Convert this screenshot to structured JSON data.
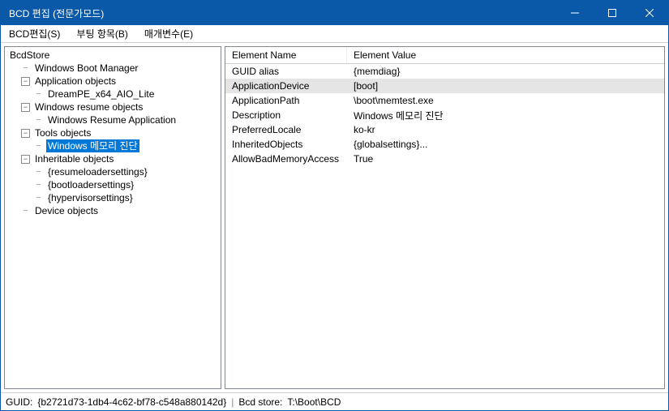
{
  "window": {
    "title": "BCD 편집 (전문가모드)"
  },
  "menu": {
    "bcd_edit": "BCD편집(S)",
    "boot_items": "부팅 항목(B)",
    "params": "매개변수(E)"
  },
  "tree": {
    "root": "BcdStore",
    "wbm": "Windows Boot Manager",
    "appobjs": "Application objects",
    "dreampe": "DreamPE_x64_AIO_Lite",
    "wro": "Windows resume objects",
    "wra": "Windows Resume Application",
    "toolsobj": "Tools objects",
    "memdiag": "Windows 메모리 진단",
    "inhobj": "Inheritable objects",
    "resumelo": "{resumeloadersettings}",
    "bootlo": "{bootloadersettings}",
    "hypset": "{hypervisorsettings}",
    "devobj": "Device objects"
  },
  "grid": {
    "hdr_name": "Element Name",
    "hdr_value": "Element Value",
    "rows": [
      {
        "n": "GUID alias",
        "v": "{memdiag}"
      },
      {
        "n": "ApplicationDevice",
        "v": "[boot]"
      },
      {
        "n": "ApplicationPath",
        "v": "\\boot\\memtest.exe"
      },
      {
        "n": "Description",
        "v": "Windows 메모리 진단"
      },
      {
        "n": "PreferredLocale",
        "v": "ko-kr"
      },
      {
        "n": "InheritedObjects",
        "v": "{globalsettings}..."
      },
      {
        "n": "AllowBadMemoryAccess",
        "v": "True"
      }
    ]
  },
  "status": {
    "guid_label": "GUID:",
    "guid": "{b2721d73-1db4-4c62-bf78-c548a880142d}",
    "store_label": "Bcd store:",
    "store": "T:\\Boot\\BCD"
  }
}
